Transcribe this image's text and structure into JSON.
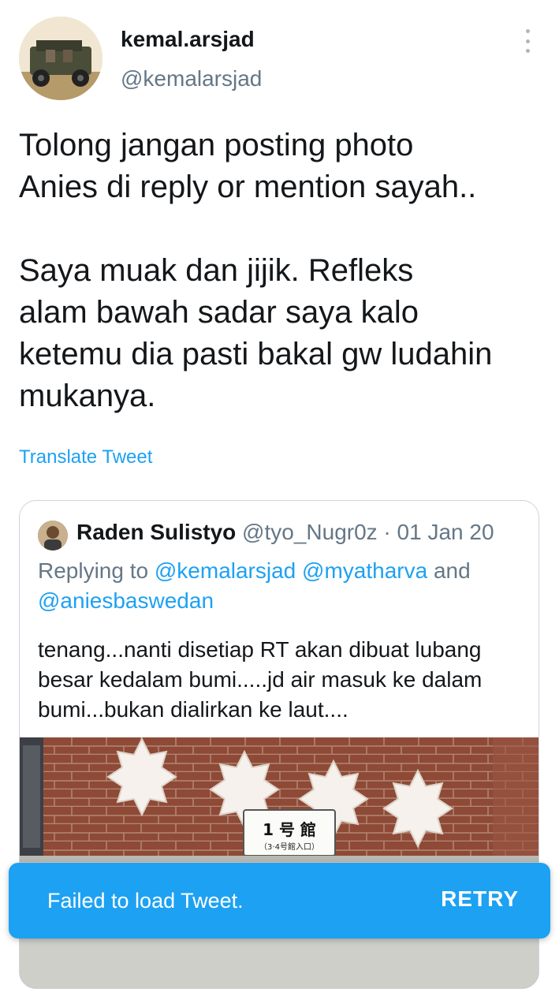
{
  "author": {
    "display_name": "kemal.arsjad",
    "handle": "@kemalarsjad",
    "avatar_icon": "profile-photo-jeep"
  },
  "tweet": {
    "text": "Tolong jangan posting photo\nAnies di reply or mention sayah..\n\nSaya muak dan jijik. Refleks\nalam bawah sadar saya kalo\nketemu dia pasti bakal gw ludahin\nmukanya.",
    "translate_label": "Translate Tweet"
  },
  "quoted": {
    "display_name": "Raden Sulistyo",
    "handle_date": "@tyo_Nugr0z · 01 Jan 20",
    "replying_prefix": "Replying to",
    "replying_to": "@kemalarsjad @myatharva",
    "replying_and": "and",
    "replying_last": "@aniesbaswedan",
    "text": "tenang...nanti disetiap RT akan dibuat lubang besar kedalam bumi.....jd air masuk ke dalam bumi...bukan dialirkan ke laut....",
    "image_sign": "1 号 館",
    "image_sign_sub": "（3·4号館入口）"
  },
  "toast": {
    "message": "Failed to load Tweet.",
    "action": "RETRY"
  },
  "colors": {
    "accent": "#1da1f2",
    "secondary_text": "#657786",
    "primary_text": "#14171a",
    "brick": "#8e4a37"
  }
}
